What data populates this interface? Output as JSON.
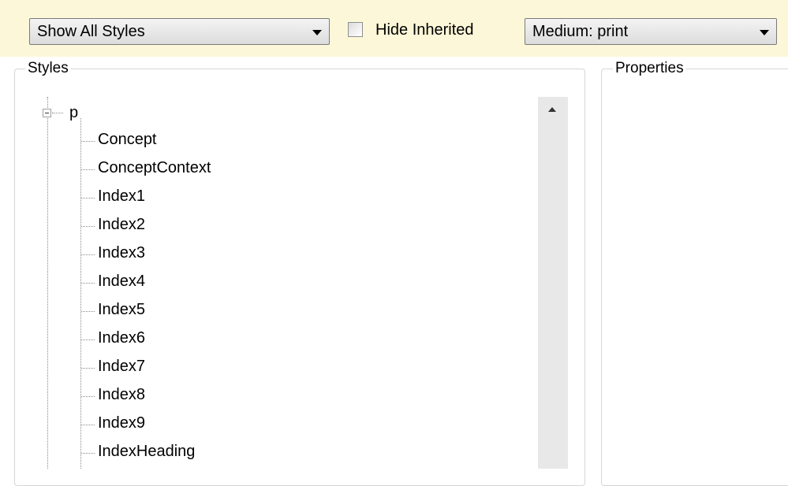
{
  "toolbar": {
    "style_filter": "Show All Styles",
    "hide_inherited_label": "Hide Inherited",
    "hide_inherited_checked": false,
    "medium": "Medium: print"
  },
  "styles_panel": {
    "title": "Styles",
    "tree": {
      "root": "p",
      "items": [
        "Concept",
        "ConceptContext",
        "Index1",
        "Index2",
        "Index3",
        "Index4",
        "Index5",
        "Index6",
        "Index7",
        "Index8",
        "Index9",
        "IndexHeading"
      ]
    }
  },
  "properties_panel": {
    "title": "Properties"
  },
  "icons": {
    "expander": "collapse-minus-icon",
    "combo_arrow": "chevron-down-icon",
    "scroll_up": "scroll-up-arrow-icon"
  }
}
